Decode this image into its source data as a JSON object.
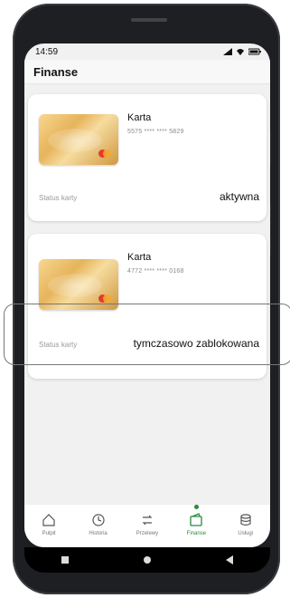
{
  "status_bar": {
    "time": "14:59"
  },
  "header": {
    "title": "Finanse"
  },
  "cards": [
    {
      "title": "Karta",
      "number": "5575 **** **** 5829",
      "status_label": "Status karty",
      "status_value": "aktywna"
    },
    {
      "title": "Karta",
      "number": "4772 **** **** 0168",
      "status_label": "Status karty",
      "status_value": "tymczasowo zablokowana"
    }
  ],
  "nav": [
    {
      "label": "Pulpit",
      "icon": "home-icon"
    },
    {
      "label": "Historia",
      "icon": "history-icon"
    },
    {
      "label": "Przelewy",
      "icon": "transfer-icon"
    },
    {
      "label": "Finanse",
      "icon": "wallet-icon",
      "active": true
    },
    {
      "label": "Usługi",
      "icon": "services-icon"
    }
  ],
  "colors": {
    "accent": "#2a8a3e",
    "card_gold": "#e6b45b"
  }
}
